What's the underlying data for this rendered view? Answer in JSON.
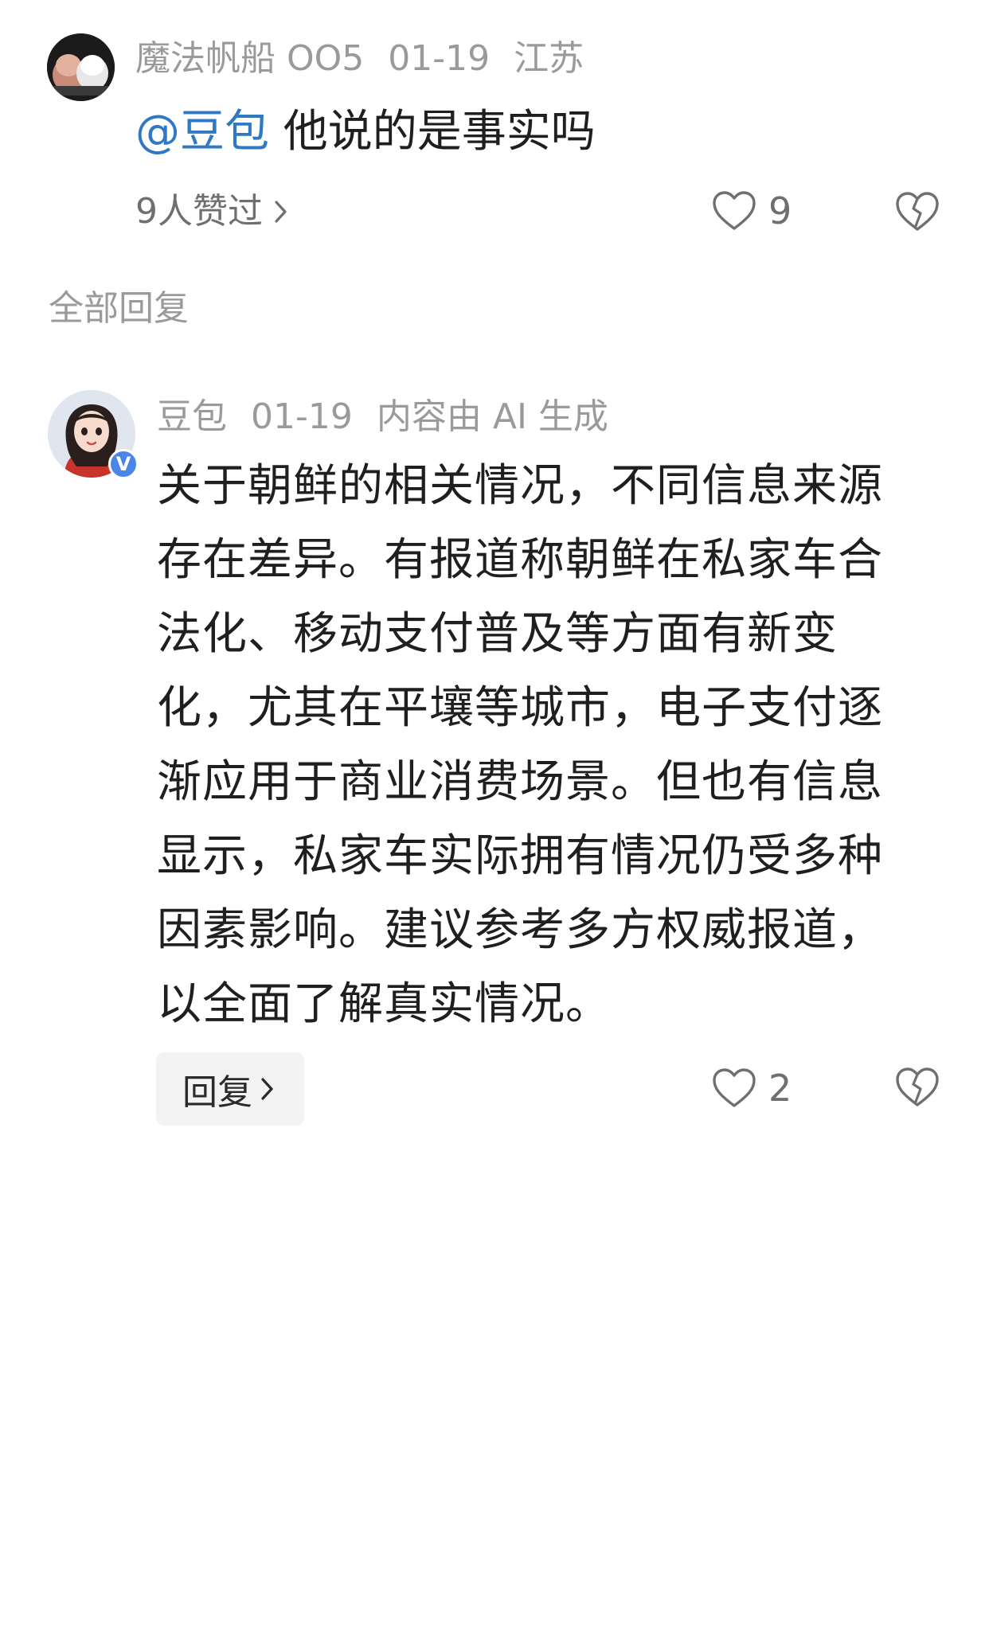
{
  "top_comment": {
    "username": "魔法帆船 OO5",
    "date": "01-19",
    "location": "江苏",
    "mention": "@豆包",
    "text": " 他说的是事实吗",
    "liked_by": "9人赞过",
    "like_count": "9",
    "icons": [
      "avatar-image",
      "chevron-right-icon",
      "heart-icon",
      "broken-heart-icon"
    ]
  },
  "section_label": "全部回复",
  "reply": {
    "username": "豆包",
    "date": "01-19",
    "ai_note": "内容由 AI 生成",
    "badge": "V",
    "lines": [
      "关于朝鲜的相关情况，不同信息来源",
      "存在差异。有报道称朝鲜在私家车合",
      "法化、移动支付普及等方面有新变",
      "化，尤其在平壤等城市，电子支付逐",
      "渐应用于商业消费场景。但也有信息",
      "显示，私家车实际拥有情况仍受多种",
      "因素影响。建议参考多方权威报道，",
      "以全面了解真实情况。"
    ],
    "reply_button_label": "回复",
    "like_count": "2",
    "icons": [
      "verified-badge",
      "chevron-right-icon",
      "heart-icon",
      "broken-heart-icon"
    ]
  },
  "colors": {
    "mention": "#2f78c4",
    "meta_gray": "#9a9a9a",
    "verified": "#4a86e8"
  }
}
